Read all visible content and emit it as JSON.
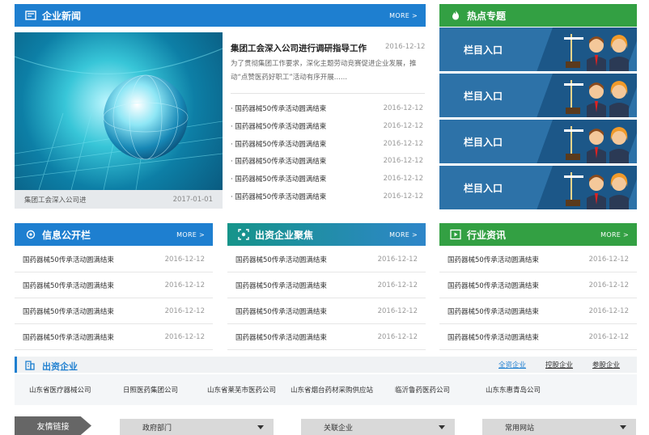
{
  "news": {
    "title": "企业新闻",
    "more": "MORE >",
    "hero_caption": "集团工会深入公司进",
    "hero_date": "2017-01-01",
    "lead_title": "集团工会深入公司进行调研指导工作",
    "lead_date": "2016-12-12",
    "lead_summary": "为了贯彻集团工作要求，深化主题劳动竞赛促进企业发展，推动“点赞医药好职工”活动有序开展......",
    "items": [
      {
        "title": "· 国药器械50传承活动圆满结束",
        "date": "2016-12-12"
      },
      {
        "title": "· 国药器械50传承活动圆满结束",
        "date": "2016-12-12"
      },
      {
        "title": "· 国药器械50传承活动圆满结束",
        "date": "2016-12-12"
      },
      {
        "title": "· 国药器械50传承活动圆满结束",
        "date": "2016-12-12"
      },
      {
        "title": "· 国药器械50传承活动圆满结束",
        "date": "2016-12-12"
      },
      {
        "title": "· 国药器械50传承活动圆满结束",
        "date": "2016-12-12"
      }
    ]
  },
  "hot": {
    "title": "热点专题",
    "items": [
      {
        "label": "栏目入口"
      },
      {
        "label": "栏目入口"
      },
      {
        "label": "栏目入口"
      },
      {
        "label": "栏目入口"
      }
    ]
  },
  "columns": [
    {
      "title": "信息公开栏",
      "more": "MORE >",
      "items": [
        {
          "title": "国药器械50传承活动圆满结束",
          "date": "2016-12-12"
        },
        {
          "title": "国药器械50传承活动圆满结束",
          "date": "2016-12-12"
        },
        {
          "title": "国药器械50传承活动圆满结束",
          "date": "2016-12-12"
        },
        {
          "title": "国药器械50传承活动圆满结束",
          "date": "2016-12-12"
        }
      ]
    },
    {
      "title": "出资企业聚焦",
      "more": "MORE >",
      "items": [
        {
          "title": "国药器械50传承活动圆满结束",
          "date": "2016-12-12"
        },
        {
          "title": "国药器械50传承活动圆满结束",
          "date": "2016-12-12"
        },
        {
          "title": "国药器械50传承活动圆满结束",
          "date": "2016-12-12"
        },
        {
          "title": "国药器械50传承活动圆满结束",
          "date": "2016-12-12"
        }
      ]
    },
    {
      "title": "行业资讯",
      "more": "MORE >",
      "items": [
        {
          "title": "国药器械50传承活动圆满结束",
          "date": "2016-12-12"
        },
        {
          "title": "国药器械50传承活动圆满结束",
          "date": "2016-12-12"
        },
        {
          "title": "国药器械50传承活动圆满结束",
          "date": "2016-12-12"
        },
        {
          "title": "国药器械50传承活动圆满结束",
          "date": "2016-12-12"
        }
      ]
    }
  ],
  "enterprises": {
    "title": "出资企业",
    "tabs": [
      "全资企业",
      "控股企业",
      "参股企业"
    ],
    "names": [
      "山东省医疗器械公司",
      "日照医药集团公司",
      "山东省莱芜市医药公司",
      "山东省烟台药材采购供应站",
      "临沂鲁药医药公司",
      "山东东惠青岛公司"
    ]
  },
  "links": {
    "title": "友情链接",
    "selects": [
      "政府部门",
      "关联企业",
      "常用网站"
    ]
  },
  "colors": {
    "blue": "#1e7fd0",
    "green": "#33a043",
    "hot_blue": "#2d72a8"
  }
}
